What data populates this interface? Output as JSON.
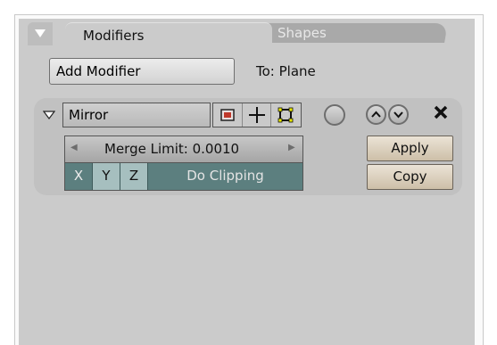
{
  "tabs": {
    "active": "Modifiers",
    "inactive": "Shapes"
  },
  "toolbar": {
    "add_modifier_label": "Add Modifier",
    "target_label": "To: Plane"
  },
  "modifier": {
    "name": "Mirror",
    "merge_limit_label": "Merge Limit: 0.0010",
    "axes": [
      "X",
      "Y",
      "Z"
    ],
    "clipping_label": "Do Clipping",
    "apply_label": "Apply",
    "copy_label": "Copy"
  },
  "icons": {
    "collapse": "triangle-down-icon",
    "expand": "triangle-down-icon",
    "render_mode": "render-icon",
    "edit_mode": "crosshair-icon",
    "cage_mode": "cage-icon",
    "toggle": "circle-icon",
    "move_up": "chevron-up-icon",
    "move_down": "chevron-down-icon",
    "delete": "close-icon"
  },
  "colors": {
    "panel_bg": "#cbcbcb",
    "toggle_on": "#5c7f7f",
    "toggle_off": "#a6bfbf",
    "action_button": "#ddd2c0"
  }
}
